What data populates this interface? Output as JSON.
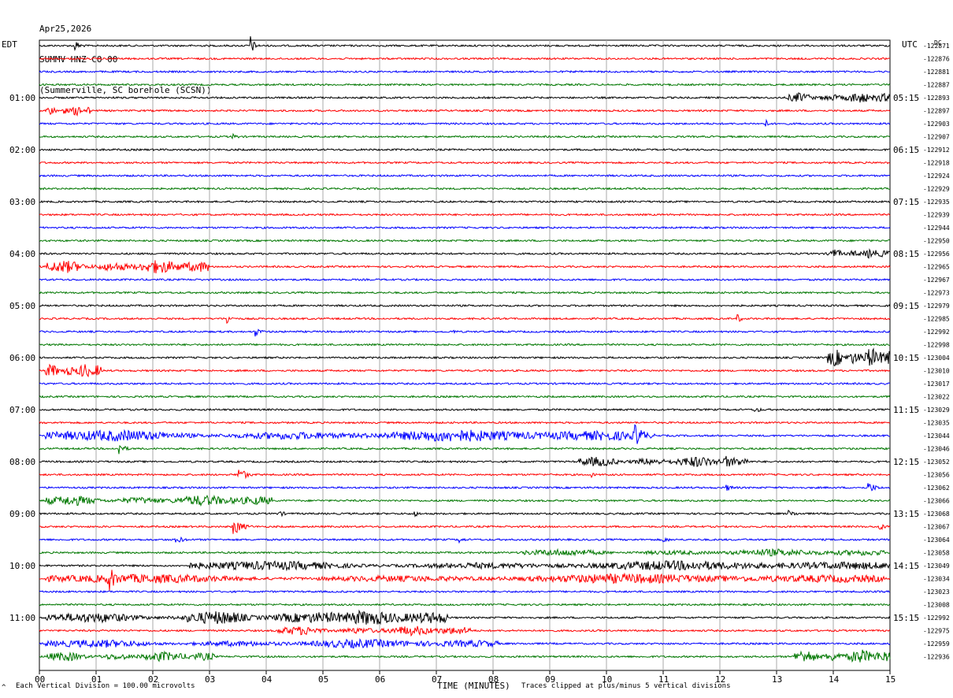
{
  "header": {
    "date": "Apr25,2026",
    "station": "SUMMV HNZ CO 00",
    "location": "(Summerville, SC borehole (SCSN))"
  },
  "left_zone": "EDT",
  "right_zone": "UTC",
  "dc_label": "DC",
  "footer": {
    "scale_text": "Each Vertical Division = 100.00 microvolts",
    "clip_text": "Traces clipped at plus/minus 5 vertical divisions",
    "corner_mark": "^"
  },
  "chart_data": {
    "type": "line",
    "title": "",
    "xlabel": "TIME (MINUTES)",
    "ylabel": "",
    "x_ticks": [
      "00",
      "01",
      "02",
      "03",
      "04",
      "05",
      "06",
      "07",
      "08",
      "09",
      "10",
      "11",
      "12",
      "13",
      "14",
      "15"
    ],
    "xlim": [
      0,
      15
    ],
    "trace_colors": [
      "#000000",
      "#ff0000",
      "#0000ff",
      "#007700"
    ],
    "left_hour_labels": [
      "01:00",
      "02:00",
      "03:00",
      "04:00",
      "05:00",
      "06:00",
      "07:00",
      "08:00",
      "09:00",
      "10:00",
      "11:00"
    ],
    "right_hour_labels": [
      "05:15",
      "06:15",
      "07:15",
      "08:15",
      "09:15",
      "10:15",
      "11:15",
      "12:15",
      "13:15",
      "14:15",
      "15:15"
    ],
    "trace_offsets": [
      "-122871",
      "-122876",
      "-122881",
      "-122887",
      "-122893",
      "-122897",
      "-122903",
      "-122907",
      "-122912",
      "-122918",
      "-122924",
      "-122929",
      "-122935",
      "-122939",
      "-122944",
      "-122950",
      "-122956",
      "-122965",
      "-122967",
      "-122973",
      "-122979",
      "-122985",
      "-122992",
      "-122998",
      "-123004",
      "-123010",
      "-123017",
      "-123022",
      "-123029",
      "-123035",
      "-123044",
      "-123046",
      "-123052",
      "-123056",
      "-123062",
      "-123066",
      "-123068",
      "-123067",
      "-123064",
      "-123058",
      "-123049",
      "-123034",
      "-123023",
      "-123008",
      "-122992",
      "-122975",
      "-122959",
      "-122936"
    ],
    "events": [
      {
        "trace": 0,
        "minute": 0.6,
        "amp": 3,
        "dur": 0.3
      },
      {
        "trace": 0,
        "minute": 3.7,
        "amp": 6,
        "dur": 0.2
      },
      {
        "trace": 4,
        "minute": 13.2,
        "amp": 2.2,
        "dur": 1.8
      },
      {
        "trace": 5,
        "minute": 0.1,
        "amp": 2,
        "dur": 0.8
      },
      {
        "trace": 6,
        "minute": 12.8,
        "amp": 2,
        "dur": 0.2
      },
      {
        "trace": 7,
        "minute": 3.4,
        "amp": 1.5,
        "dur": 0.3
      },
      {
        "trace": 11,
        "minute": 9.6,
        "amp": 1,
        "dur": 0.2
      },
      {
        "trace": 16,
        "minute": 13.9,
        "amp": 2,
        "dur": 1.1
      },
      {
        "trace": 17,
        "minute": 0.1,
        "amp": 2.8,
        "dur": 2.9
      },
      {
        "trace": 21,
        "minute": 3.3,
        "amp": 3,
        "dur": 0.2
      },
      {
        "trace": 21,
        "minute": 12.3,
        "amp": 2.5,
        "dur": 0.2
      },
      {
        "trace": 22,
        "minute": 3.8,
        "amp": 2.2,
        "dur": 0.3
      },
      {
        "trace": 22,
        "minute": 7.3,
        "amp": 1,
        "dur": 0.2
      },
      {
        "trace": 24,
        "minute": 13.9,
        "amp": 4,
        "dur": 1.1
      },
      {
        "trace": 25,
        "minute": 0.1,
        "amp": 3,
        "dur": 1
      },
      {
        "trace": 28,
        "minute": 12.6,
        "amp": 2,
        "dur": 0.3
      },
      {
        "trace": 30,
        "minute": 0.1,
        "amp": 2.5,
        "dur": 10.4
      },
      {
        "trace": 30,
        "minute": 10.5,
        "amp": 5,
        "dur": 0.5
      },
      {
        "trace": 31,
        "minute": 1.4,
        "amp": 3,
        "dur": 0.3
      },
      {
        "trace": 32,
        "minute": 9.5,
        "amp": 2.2,
        "dur": 3
      },
      {
        "trace": 32,
        "minute": 12.1,
        "amp": 3.5,
        "dur": 0.4
      },
      {
        "trace": 33,
        "minute": 3.5,
        "amp": 3.5,
        "dur": 0.4
      },
      {
        "trace": 33,
        "minute": 9.7,
        "amp": 2,
        "dur": 0.2
      },
      {
        "trace": 34,
        "minute": 12.1,
        "amp": 1.5,
        "dur": 0.5
      },
      {
        "trace": 34,
        "minute": 14.6,
        "amp": 2.8,
        "dur": 0.4
      },
      {
        "trace": 35,
        "minute": 0.1,
        "amp": 2.2,
        "dur": 4
      },
      {
        "trace": 36,
        "minute": 4.2,
        "amp": 2,
        "dur": 0.3
      },
      {
        "trace": 36,
        "minute": 6.6,
        "amp": 1.5,
        "dur": 0.3
      },
      {
        "trace": 36,
        "minute": 13.2,
        "amp": 1.5,
        "dur": 0.5
      },
      {
        "trace": 37,
        "minute": 3.4,
        "amp": 4,
        "dur": 0.5
      },
      {
        "trace": 37,
        "minute": 14.8,
        "amp": 2,
        "dur": 0.3
      },
      {
        "trace": 38,
        "minute": 2.4,
        "amp": 2,
        "dur": 0.4
      },
      {
        "trace": 38,
        "minute": 7.4,
        "amp": 1.5,
        "dur": 0.3
      },
      {
        "trace": 38,
        "minute": 11.0,
        "amp": 1.5,
        "dur": 0.3
      },
      {
        "trace": 39,
        "minute": 8.5,
        "amp": 1.5,
        "dur": 6.4
      },
      {
        "trace": 40,
        "minute": 2.6,
        "amp": 2,
        "dur": 12.4
      },
      {
        "trace": 41,
        "minute": 0.1,
        "amp": 2,
        "dur": 14.8
      },
      {
        "trace": 41,
        "minute": 1.2,
        "amp": 6,
        "dur": 0.5
      },
      {
        "trace": 44,
        "minute": 0.1,
        "amp": 2.2,
        "dur": 7.1
      },
      {
        "trace": 44,
        "minute": 2.6,
        "amp": 3,
        "dur": 4.6
      },
      {
        "trace": 45,
        "minute": 4.2,
        "amp": 2,
        "dur": 3.4
      },
      {
        "trace": 46,
        "minute": 0.1,
        "amp": 1.8,
        "dur": 8
      },
      {
        "trace": 47,
        "minute": 0.1,
        "amp": 2,
        "dur": 3
      },
      {
        "trace": 47,
        "minute": 13.3,
        "amp": 3,
        "dur": 1.7
      }
    ]
  }
}
